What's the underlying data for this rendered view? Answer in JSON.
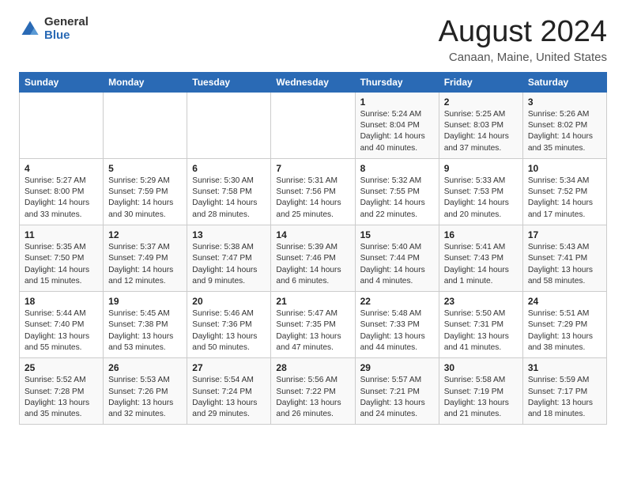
{
  "logo": {
    "general": "General",
    "blue": "Blue"
  },
  "title": "August 2024",
  "subtitle": "Canaan, Maine, United States",
  "days_header": [
    "Sunday",
    "Monday",
    "Tuesday",
    "Wednesday",
    "Thursday",
    "Friday",
    "Saturday"
  ],
  "weeks": [
    [
      {
        "num": "",
        "info": ""
      },
      {
        "num": "",
        "info": ""
      },
      {
        "num": "",
        "info": ""
      },
      {
        "num": "",
        "info": ""
      },
      {
        "num": "1",
        "info": "Sunrise: 5:24 AM\nSunset: 8:04 PM\nDaylight: 14 hours\nand 40 minutes."
      },
      {
        "num": "2",
        "info": "Sunrise: 5:25 AM\nSunset: 8:03 PM\nDaylight: 14 hours\nand 37 minutes."
      },
      {
        "num": "3",
        "info": "Sunrise: 5:26 AM\nSunset: 8:02 PM\nDaylight: 14 hours\nand 35 minutes."
      }
    ],
    [
      {
        "num": "4",
        "info": "Sunrise: 5:27 AM\nSunset: 8:00 PM\nDaylight: 14 hours\nand 33 minutes."
      },
      {
        "num": "5",
        "info": "Sunrise: 5:29 AM\nSunset: 7:59 PM\nDaylight: 14 hours\nand 30 minutes."
      },
      {
        "num": "6",
        "info": "Sunrise: 5:30 AM\nSunset: 7:58 PM\nDaylight: 14 hours\nand 28 minutes."
      },
      {
        "num": "7",
        "info": "Sunrise: 5:31 AM\nSunset: 7:56 PM\nDaylight: 14 hours\nand 25 minutes."
      },
      {
        "num": "8",
        "info": "Sunrise: 5:32 AM\nSunset: 7:55 PM\nDaylight: 14 hours\nand 22 minutes."
      },
      {
        "num": "9",
        "info": "Sunrise: 5:33 AM\nSunset: 7:53 PM\nDaylight: 14 hours\nand 20 minutes."
      },
      {
        "num": "10",
        "info": "Sunrise: 5:34 AM\nSunset: 7:52 PM\nDaylight: 14 hours\nand 17 minutes."
      }
    ],
    [
      {
        "num": "11",
        "info": "Sunrise: 5:35 AM\nSunset: 7:50 PM\nDaylight: 14 hours\nand 15 minutes."
      },
      {
        "num": "12",
        "info": "Sunrise: 5:37 AM\nSunset: 7:49 PM\nDaylight: 14 hours\nand 12 minutes."
      },
      {
        "num": "13",
        "info": "Sunrise: 5:38 AM\nSunset: 7:47 PM\nDaylight: 14 hours\nand 9 minutes."
      },
      {
        "num": "14",
        "info": "Sunrise: 5:39 AM\nSunset: 7:46 PM\nDaylight: 14 hours\nand 6 minutes."
      },
      {
        "num": "15",
        "info": "Sunrise: 5:40 AM\nSunset: 7:44 PM\nDaylight: 14 hours\nand 4 minutes."
      },
      {
        "num": "16",
        "info": "Sunrise: 5:41 AM\nSunset: 7:43 PM\nDaylight: 14 hours\nand 1 minute."
      },
      {
        "num": "17",
        "info": "Sunrise: 5:43 AM\nSunset: 7:41 PM\nDaylight: 13 hours\nand 58 minutes."
      }
    ],
    [
      {
        "num": "18",
        "info": "Sunrise: 5:44 AM\nSunset: 7:40 PM\nDaylight: 13 hours\nand 55 minutes."
      },
      {
        "num": "19",
        "info": "Sunrise: 5:45 AM\nSunset: 7:38 PM\nDaylight: 13 hours\nand 53 minutes."
      },
      {
        "num": "20",
        "info": "Sunrise: 5:46 AM\nSunset: 7:36 PM\nDaylight: 13 hours\nand 50 minutes."
      },
      {
        "num": "21",
        "info": "Sunrise: 5:47 AM\nSunset: 7:35 PM\nDaylight: 13 hours\nand 47 minutes."
      },
      {
        "num": "22",
        "info": "Sunrise: 5:48 AM\nSunset: 7:33 PM\nDaylight: 13 hours\nand 44 minutes."
      },
      {
        "num": "23",
        "info": "Sunrise: 5:50 AM\nSunset: 7:31 PM\nDaylight: 13 hours\nand 41 minutes."
      },
      {
        "num": "24",
        "info": "Sunrise: 5:51 AM\nSunset: 7:29 PM\nDaylight: 13 hours\nand 38 minutes."
      }
    ],
    [
      {
        "num": "25",
        "info": "Sunrise: 5:52 AM\nSunset: 7:28 PM\nDaylight: 13 hours\nand 35 minutes."
      },
      {
        "num": "26",
        "info": "Sunrise: 5:53 AM\nSunset: 7:26 PM\nDaylight: 13 hours\nand 32 minutes."
      },
      {
        "num": "27",
        "info": "Sunrise: 5:54 AM\nSunset: 7:24 PM\nDaylight: 13 hours\nand 29 minutes."
      },
      {
        "num": "28",
        "info": "Sunrise: 5:56 AM\nSunset: 7:22 PM\nDaylight: 13 hours\nand 26 minutes."
      },
      {
        "num": "29",
        "info": "Sunrise: 5:57 AM\nSunset: 7:21 PM\nDaylight: 13 hours\nand 24 minutes."
      },
      {
        "num": "30",
        "info": "Sunrise: 5:58 AM\nSunset: 7:19 PM\nDaylight: 13 hours\nand 21 minutes."
      },
      {
        "num": "31",
        "info": "Sunrise: 5:59 AM\nSunset: 7:17 PM\nDaylight: 13 hours\nand 18 minutes."
      }
    ]
  ]
}
